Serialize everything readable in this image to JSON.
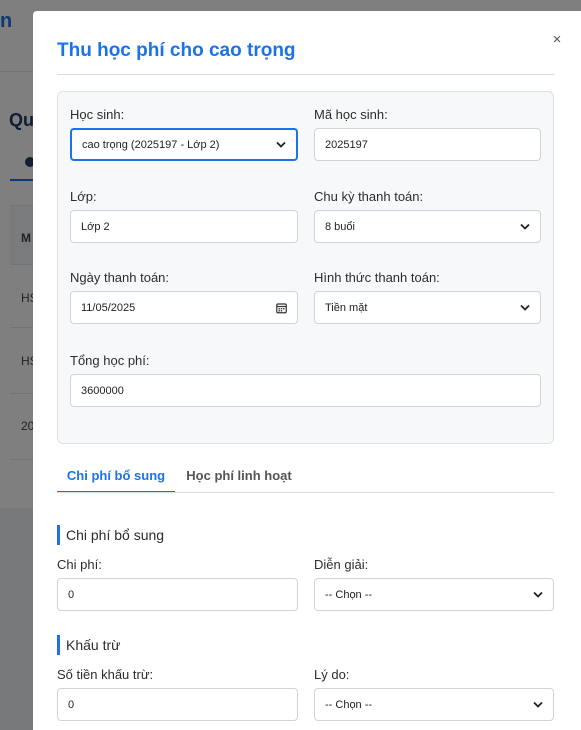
{
  "background": {
    "brand_fragment": "n",
    "page_title_fragment": "Qu",
    "table_header_fragment": "M",
    "row_fragments": [
      "HS",
      "HS",
      "20"
    ]
  },
  "modal": {
    "title": "Thu học phí cho cao trọng",
    "close_symbol": "×",
    "student": {
      "label": "Học sinh:",
      "value": "cao trọng (2025197 - Lớp 2)"
    },
    "student_code": {
      "label": "Mã học sinh:",
      "value": "2025197"
    },
    "class": {
      "label": "Lớp:",
      "value": "Lớp 2"
    },
    "payment_cycle": {
      "label": "Chu kỳ thanh toán:",
      "value": "8 buổi"
    },
    "payment_date": {
      "label": "Ngày thanh toán:",
      "value": "11/05/2025"
    },
    "payment_method": {
      "label": "Hình thức thanh toán:",
      "value": "Tiền mặt"
    },
    "total_fee": {
      "label": "Tổng học phí:",
      "value": "3600000"
    },
    "tabs": [
      {
        "label": "Chi phí bổ sung",
        "active": true
      },
      {
        "label": "Học phí linh hoạt",
        "active": false
      }
    ],
    "extra_cost_section": {
      "heading": "Chi phí bổ sung",
      "cost": {
        "label": "Chi phí:",
        "value": "0"
      },
      "explanation": {
        "label": "Diễn giải:",
        "value": "-- Chọn --"
      }
    },
    "deduction_section": {
      "heading": "Khấu trừ",
      "amount": {
        "label": "Số tiền khấu trừ:",
        "value": "0"
      },
      "reason": {
        "label": "Lý do:",
        "value": "-- Chọn --"
      }
    }
  },
  "colors": {
    "accent": "#1a73e8",
    "overlay": "rgba(0,0,0,0.5)",
    "card_bg": "#f7f8f9"
  }
}
